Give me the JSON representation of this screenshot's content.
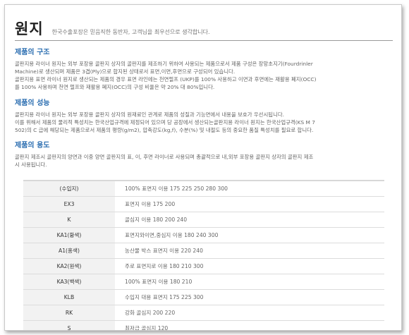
{
  "header": {
    "title": "원지",
    "subtitle": "한국수출포장은 믿음직한 동반자, 고객님을 최우선으로 생각합니다."
  },
  "sections": [
    {
      "heading": "제품의 구조",
      "lines": [
        "골판지용 라이너 원지는 외부 포장용 골판지 상자의 골판지를 제조하기 위하여 사용되는 제품으로서 제품 구성은 장망초지기(Fourdrinler",
        "Machine)로 생산되며 제품은 3겹(Ply)으로 합지된 상태로서 표면,이면,후면으로 구성되어 있습니다.",
        "골판지용 표면 라이너 원지로 생산되는 제품의 경우 표면 라인에는 천연펄프 (UKP)를 100% 사용하고 이면과 후면에는 재활용 폐지(OCC)",
        "를 100% 사용하며 천연 펄프와 재활용 폐지(OCC)의 구성 비율은 약 20% 대 80%입니다."
      ]
    },
    {
      "heading": "제품의 성능",
      "lines": [
        "골판지용 라이너 원지는 외부 포장용 골판지 상자의 원재료인 관계로 제품의 성질과 기능면에서 내용을 보호가 우선시됩니다.",
        "이를 위해서 제품의 물리적 특성치는 한국산업규격에 제정되어 있으며 당 공장에서 생산되는골판지용 라이너 원지는 한국산업규격(KS M 7",
        "502)의 C 급에 해당되는 제품으로서 제품의 평량(g/m2), 압축강도(kg,f), 수분(%) 및 내절도 등의 중요한 품질 특성치를 필요로 합니다."
      ]
    },
    {
      "heading": "제품의 용도",
      "lines": [
        "골판지 제조시 골판지의 양면과 이중 양면 골판지의 표, 이, 후면 라이너로 사용되며 총괄적으로 내,외부 포장용 골판지 상자의 골판지 제조",
        "시 사용됩니다."
      ]
    }
  ],
  "table": [
    {
      "code": "(수입지)",
      "desc": "100% 표면지 이용 175 225 250 280 300"
    },
    {
      "code": "EX3",
      "desc": "표면지 이용 175 200"
    },
    {
      "code": "K",
      "desc": "골심지 이용 180 200 240"
    },
    {
      "code": "KA1(황색)",
      "desc": "표면지와이면,중심지 이용 180 240 300"
    },
    {
      "code": "A1(홍색)",
      "desc": "농산물 박스 표면지 이용 220 240"
    },
    {
      "code": "KA2(원색)",
      "desc": "주로 표면지로 이용 180 210 300"
    },
    {
      "code": "KA3(백색)",
      "desc": "100% 표면지 이용 180 210"
    },
    {
      "code": "KLB",
      "desc": "수입지 대용 표면지 175 225 300"
    },
    {
      "code": "RK",
      "desc": "강화 골심지 200 220"
    },
    {
      "code": "S",
      "desc": "최저급 골심지 120"
    }
  ]
}
